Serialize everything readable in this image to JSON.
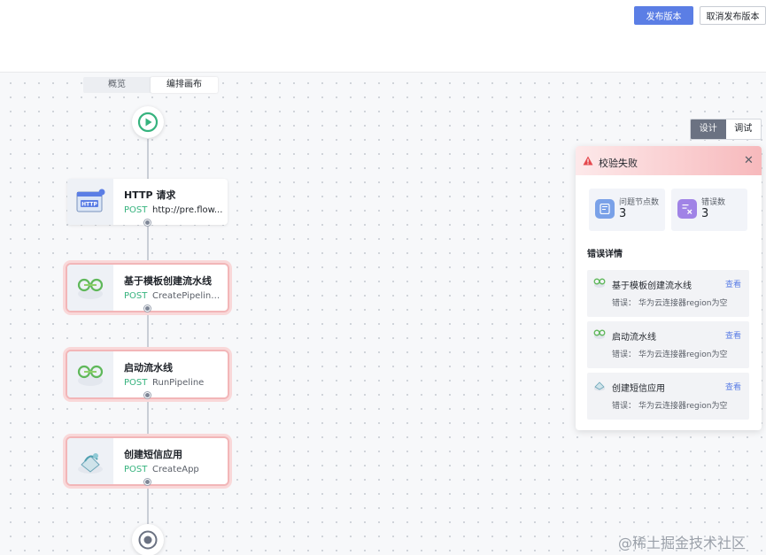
{
  "header": {
    "publish_label": "发布版本",
    "unpublish_label": "取消发布版本"
  },
  "tabs": [
    {
      "label": "概览"
    },
    {
      "label": "编排画布"
    }
  ],
  "mode_switch": {
    "design_label": "设计",
    "debug_label": "调试"
  },
  "flow": {
    "nodes": [
      {
        "title": "HTTP 请求",
        "method": "POST",
        "subtitle": "http://pre.flow...",
        "icon": "http-icon",
        "status": "ok"
      },
      {
        "title": "基于模板创建流水线",
        "method": "POST",
        "subtitle": "CreatePipelineB...",
        "icon": "pipeline-icon",
        "status": "error"
      },
      {
        "title": "启动流水线",
        "method": "POST",
        "subtitle": "RunPipeline",
        "icon": "pipeline-icon",
        "status": "error"
      },
      {
        "title": "创建短信应用",
        "method": "POST",
        "subtitle": "CreateApp",
        "icon": "cloud-app-icon",
        "status": "error"
      }
    ]
  },
  "validation_panel": {
    "title": "校验失败",
    "stats": [
      {
        "label": "问题节点数",
        "value": "3"
      },
      {
        "label": "错误数",
        "value": "3"
      }
    ],
    "section_title": "错误详情",
    "errors": [
      {
        "title": "基于模板创建流水线",
        "view_label": "查看",
        "msg_label": "错误：",
        "msg": "华为云连接器region为空"
      },
      {
        "title": "启动流水线",
        "view_label": "查看",
        "msg_label": "错误：",
        "msg": "华为云连接器region为空"
      },
      {
        "title": "创建短信应用",
        "view_label": "查看",
        "msg_label": "错误：",
        "msg": "华为云连接器region为空"
      }
    ]
  },
  "colors": {
    "primary": "#5b7ee5",
    "success": "#36b37e",
    "error_border": "#f2b6b8"
  },
  "watermark": "@稀土掘金技术社区"
}
